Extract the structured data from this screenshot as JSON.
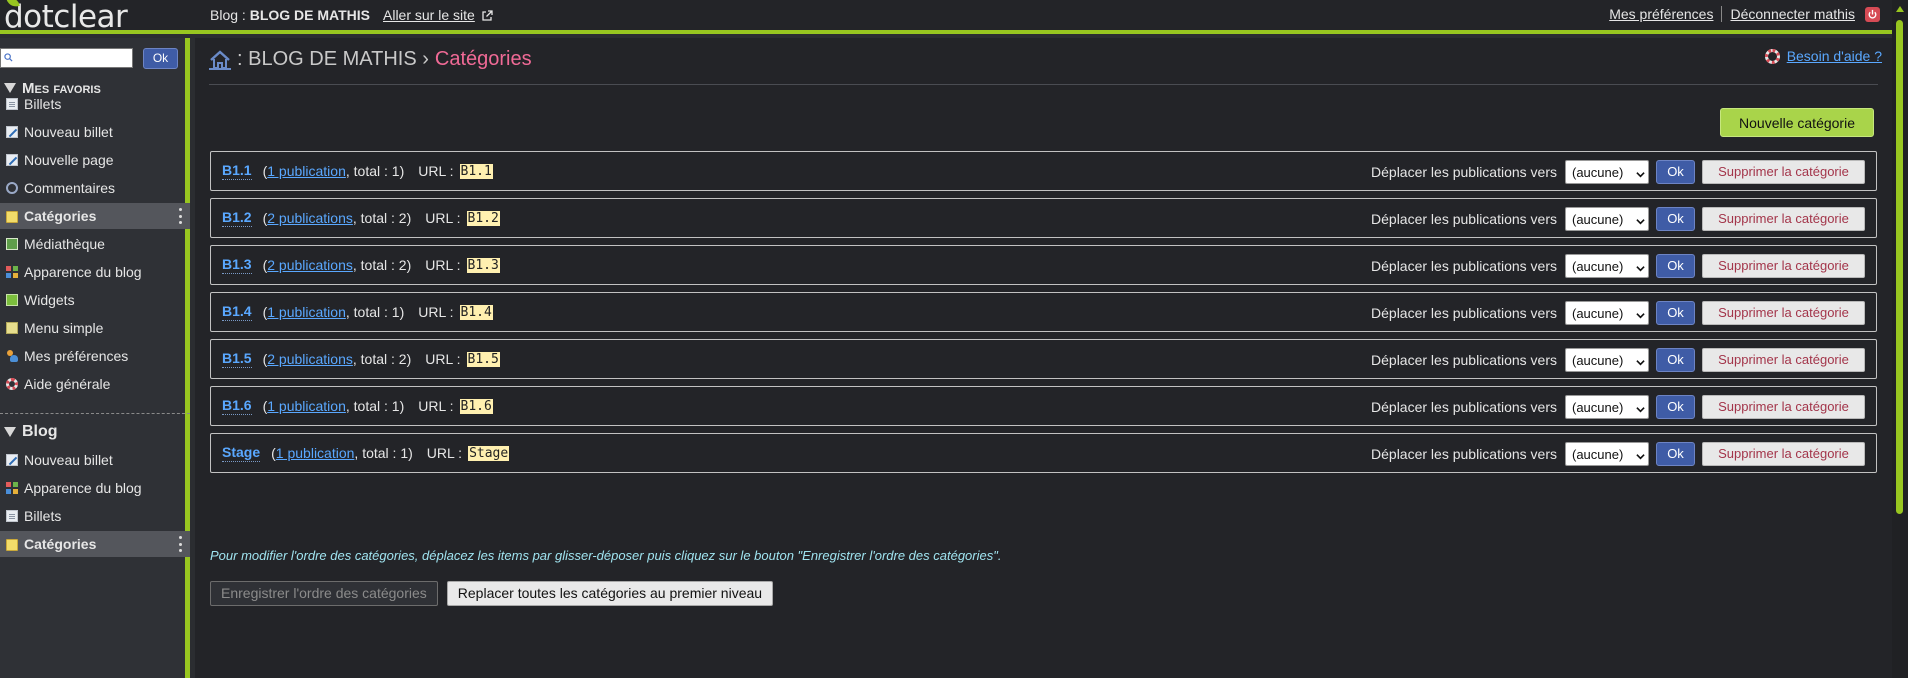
{
  "header": {
    "logo": "dotclear",
    "blog_prefix": "Blog :",
    "blog_name": "BLOG DE MATHIS",
    "goto_site": "Aller sur le site",
    "preferences": "Mes préférences",
    "logout": "Déconnecter mathis"
  },
  "sidebar": {
    "search": {
      "value": "",
      "placeholder": ""
    },
    "search_ok": "Ok",
    "favorites_title": "Mes favoris",
    "favorites": [
      {
        "label": "Billets",
        "icon": "document-icon"
      },
      {
        "label": "Nouveau billet",
        "icon": "pencil-icon"
      },
      {
        "label": "Nouvelle page",
        "icon": "pencil-icon"
      },
      {
        "label": "Commentaires",
        "icon": "comment-bubble-icon"
      },
      {
        "label": "Catégories",
        "icon": "folder-icon",
        "active": true
      },
      {
        "label": "Médiathèque",
        "icon": "image-icon"
      },
      {
        "label": "Apparence du blog",
        "icon": "grid-icon"
      },
      {
        "label": "Widgets",
        "icon": "widget-icon"
      },
      {
        "label": "Menu simple",
        "icon": "menu-icon"
      },
      {
        "label": "Mes préférences",
        "icon": "user-icon"
      },
      {
        "label": "Aide générale",
        "icon": "help-icon"
      }
    ],
    "blog_title": "Blog",
    "blog_items": [
      {
        "label": "Nouveau billet",
        "icon": "pencil-icon"
      },
      {
        "label": "Apparence du blog",
        "icon": "grid-icon"
      },
      {
        "label": "Billets",
        "icon": "document-icon"
      },
      {
        "label": "Catégories",
        "icon": "folder-icon",
        "active": true
      }
    ]
  },
  "main": {
    "breadcrumb_blog": ": BLOG DE MATHIS ›",
    "breadcrumb_current": "Catégories",
    "help": "Besoin d'aide ?",
    "new_category": "Nouvelle catégorie",
    "move_label": "Déplacer les publications vers",
    "move_select_value": "(aucune)",
    "ok_label": "Ok",
    "delete_label": "Supprimer la catégorie",
    "url_label": "URL :",
    "categories": [
      {
        "name": "B1.1",
        "pubs": "1 publication",
        "total": ", total : 1)",
        "url": "B1.1"
      },
      {
        "name": "B1.2",
        "pubs": "2 publications",
        "total": ", total : 2)",
        "url": "B1.2"
      },
      {
        "name": "B1.3",
        "pubs": "2 publications",
        "total": ", total : 2)",
        "url": "B1.3"
      },
      {
        "name": "B1.4",
        "pubs": "1 publication",
        "total": ", total : 1)",
        "url": "B1.4"
      },
      {
        "name": "B1.5",
        "pubs": "2 publications",
        "total": ", total : 2)",
        "url": "B1.5"
      },
      {
        "name": "B1.6",
        "pubs": "1 publication",
        "total": ", total : 1)",
        "url": "B1.6"
      },
      {
        "name": "Stage",
        "pubs": "1 publication",
        "total": ", total : 1)",
        "url": "Stage"
      }
    ],
    "hint": "Pour modifier l'ordre des catégories, déplacez les items par glisser-déposer puis cliquez sur le bouton \"Enregistrer l'ordre des catégories\".",
    "save_order": "Enregistrer l'ordre des catégories",
    "reset_level": "Replacer toutes les catégories au premier niveau"
  },
  "colors": {
    "accent": "#98c620",
    "link": "#5aa8ff",
    "current_crumb": "#f06a96",
    "ok_button": "#3f5ca6",
    "new_category_button": "#a9d44a"
  }
}
